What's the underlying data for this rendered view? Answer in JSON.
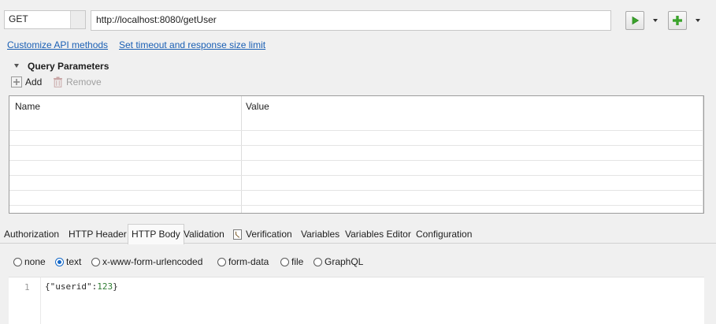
{
  "request": {
    "method": "GET",
    "url": "http://localhost:8080/getUser"
  },
  "links": {
    "customize": "Customize API methods",
    "timeout": "Set timeout and response size limit"
  },
  "query_params": {
    "title": "Query Parameters",
    "add_label": "Add",
    "remove_label": "Remove",
    "columns": [
      "Name",
      "Value"
    ],
    "rows": []
  },
  "tabs": [
    {
      "label": "Authorization"
    },
    {
      "label": "HTTP Header"
    },
    {
      "label": "HTTP Body",
      "active": true
    },
    {
      "label": "Validation"
    },
    {
      "label": "Verification",
      "icon": "script-icon"
    },
    {
      "label": "Variables"
    },
    {
      "label": "Variables Editor"
    },
    {
      "label": "Configuration"
    }
  ],
  "body_type": {
    "options": [
      "none",
      "text",
      "x-www-form-urlencoded",
      "form-data",
      "file",
      "GraphQL"
    ],
    "selected": "text"
  },
  "editor": {
    "line_number": "1",
    "code_prefix": "{\"userid\":",
    "code_number": "123",
    "code_suffix": "}"
  },
  "colors": {
    "accent": "#1468c8",
    "link": "#1a5fb4",
    "run_green": "#3aa32b"
  }
}
